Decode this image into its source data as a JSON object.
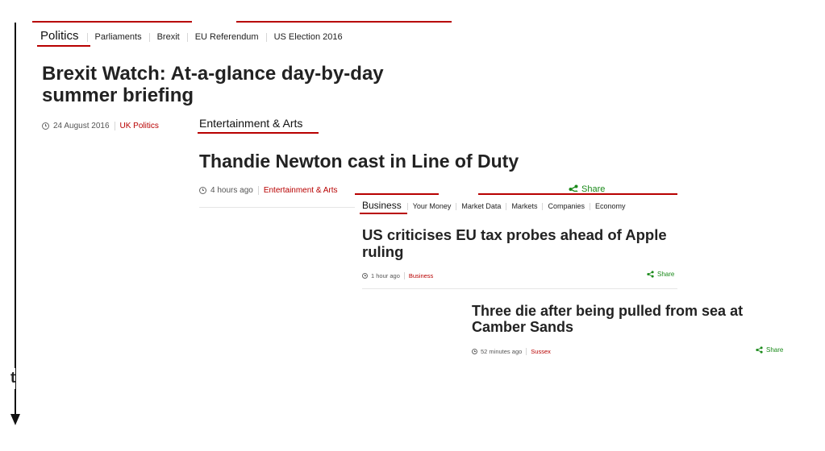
{
  "timeline": {
    "label": "t"
  },
  "cards": {
    "politics": {
      "section": "Politics",
      "nav": [
        "Parliaments",
        "Brexit",
        "EU Referendum",
        "US Election 2016"
      ],
      "headline": "Brexit Watch: At-a-glance day-by-day summer briefing",
      "date": "24 August 2016",
      "category": "UK Politics"
    },
    "entertainment": {
      "section": "Entertainment & Arts",
      "headline": "Thandie Newton cast in Line of Duty",
      "time": "4 hours ago",
      "category": "Entertainment & Arts",
      "share": "Share"
    },
    "business": {
      "section": "Business",
      "nav": [
        "Your Money",
        "Market Data",
        "Markets",
        "Companies",
        "Economy"
      ],
      "headline": "US criticises EU tax probes ahead of Apple ruling",
      "time": "1 hour ago",
      "category": "Business",
      "share": "Share"
    },
    "sussex": {
      "headline": "Three die after being pulled from sea at Camber Sands",
      "time": "52 minutes ago",
      "category": "Sussex",
      "share": "Share"
    }
  },
  "colors": {
    "accent": "#b80000",
    "share": "#1a8a1a",
    "text": "#222222"
  }
}
